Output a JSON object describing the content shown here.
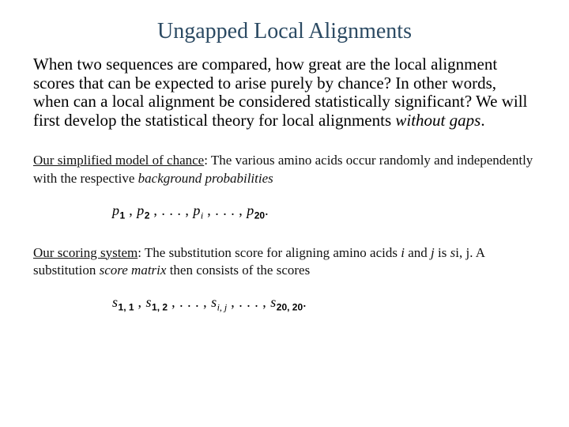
{
  "title": "Ungapped Local Alignments",
  "intro": {
    "part1": "When two sequences are compared, how great are the local alignment scores that can be expected to arise purely by chance?  In other words, when can a local alignment be considered statistically significant?  We will first develop the statistical theory for local alignments ",
    "ital": "without gaps",
    "part2": "."
  },
  "model": {
    "label": "Our simplified model of chance",
    "text": ":  The various amino acids occur randomly and independently with the respective ",
    "ital": "background probabilities"
  },
  "p_list": {
    "p": "p",
    "s1": "1",
    "s2": "2",
    "si": "i",
    "s20": "20",
    "comma": " ,   ",
    "dots": ". . . ,   ",
    "period": "."
  },
  "scoring": {
    "label": "Our scoring system",
    "text1": ":   The substitution score for aligning amino acids ",
    "i": "i",
    "and": " and ",
    "j": "j",
    "text2": " is ",
    "sij_s": "s",
    "sij_sub": "i, j",
    "text3": ".  A substitution ",
    "ital": "score matrix",
    "text4": " then consists of the scores"
  },
  "s_list": {
    "s": "s",
    "s11": "1, 1",
    "s12": "1, 2",
    "sij": "i, j",
    "s2020": "20, 20",
    "comma": " ,   ",
    "dots": ". . . ,   ",
    "period": "."
  }
}
